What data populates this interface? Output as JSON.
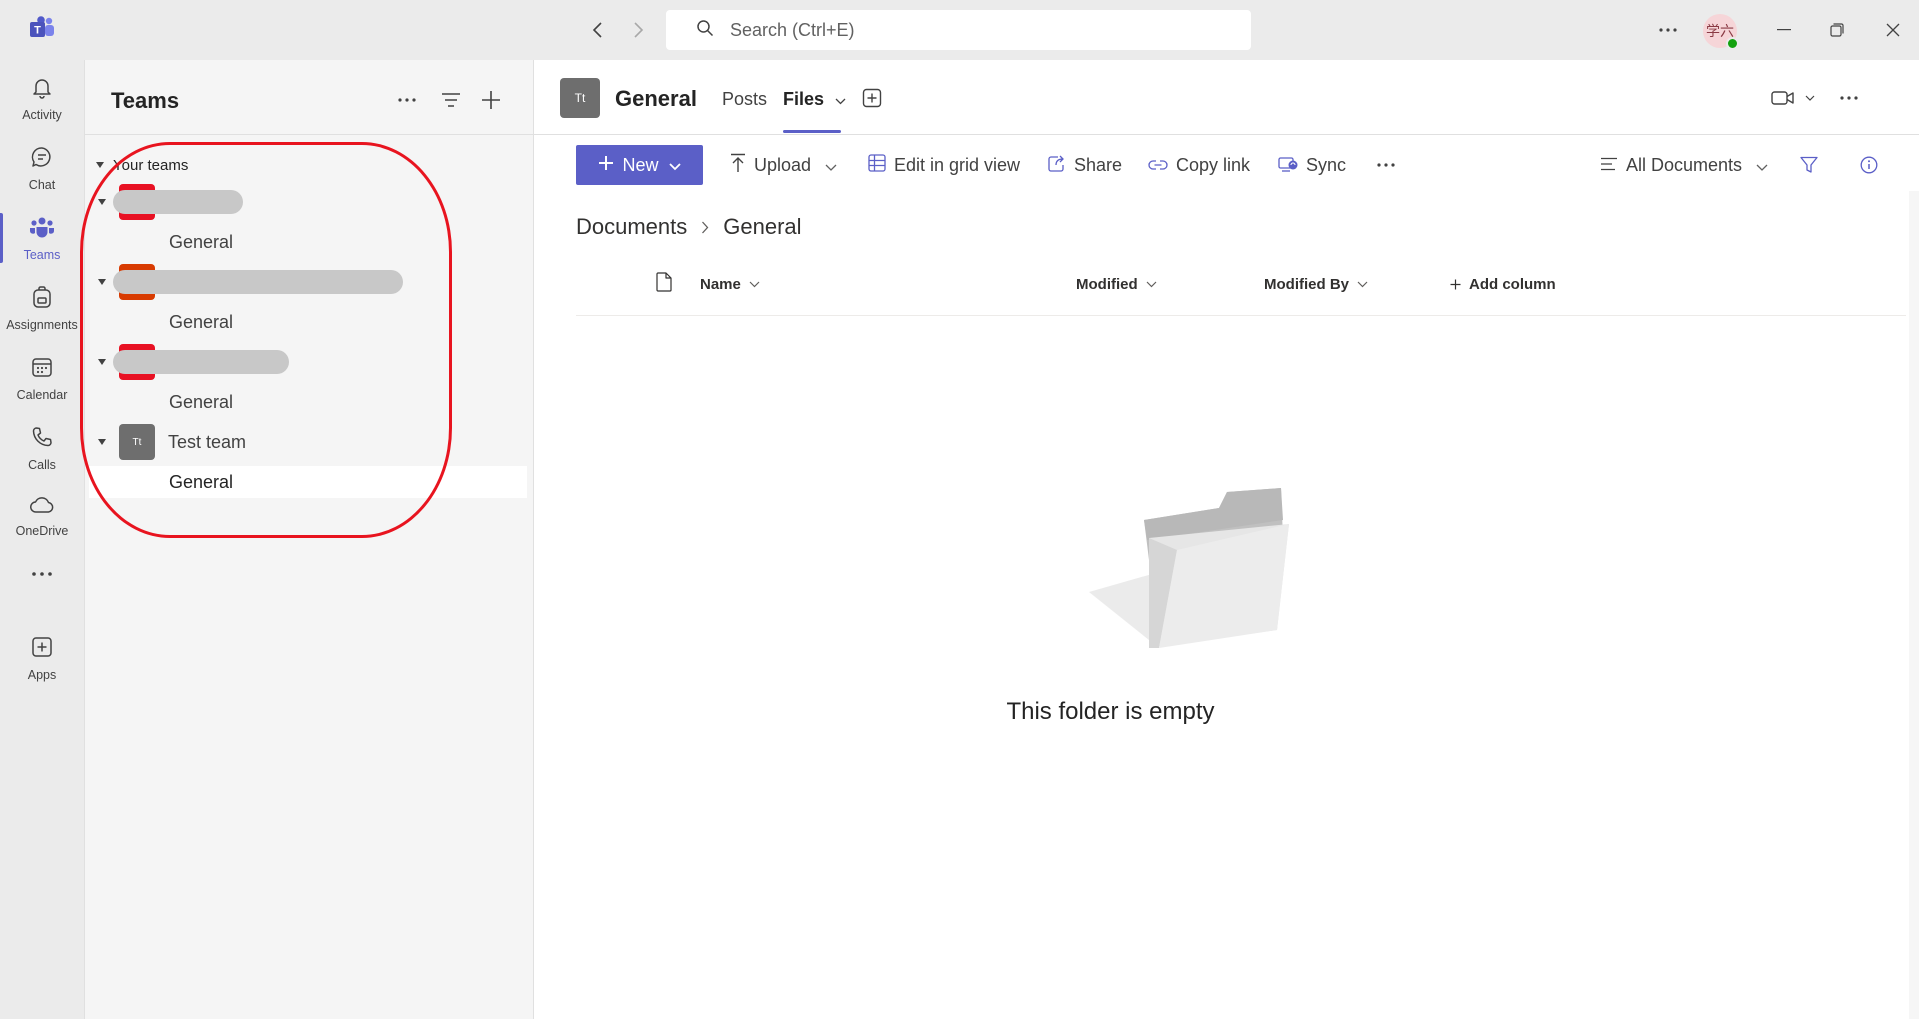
{
  "titlebar": {
    "search_placeholder": "Search (Ctrl+E)",
    "avatar_initials": "学六"
  },
  "appbar": {
    "items": [
      {
        "label": "Activity",
        "icon": "bell-icon"
      },
      {
        "label": "Chat",
        "icon": "chat-icon"
      },
      {
        "label": "Teams",
        "icon": "teams-icon",
        "active": true
      },
      {
        "label": "Assignments",
        "icon": "backpack-icon"
      },
      {
        "label": "Calendar",
        "icon": "calendar-icon"
      },
      {
        "label": "Calls",
        "icon": "phone-icon"
      },
      {
        "label": "OneDrive",
        "icon": "cloud-icon"
      },
      {
        "label": "Apps",
        "icon": "add-app-icon"
      }
    ]
  },
  "teams_panel": {
    "title": "Teams",
    "section_label": "Your teams",
    "teams": [
      {
        "name": "",
        "redacted": true,
        "tile_color": "#e81123",
        "channel": "General"
      },
      {
        "name": "",
        "redacted": true,
        "tile_color": "#d83b01",
        "channel": "General"
      },
      {
        "name": "",
        "redacted": true,
        "tile_color": "#e81123",
        "channel": "General"
      },
      {
        "name": "Test team",
        "redacted": false,
        "tile_initials": "Tt",
        "channel": "General",
        "selected": true
      }
    ]
  },
  "channel_header": {
    "tile_initials": "Tt",
    "title": "General",
    "tabs": [
      {
        "label": "Posts"
      },
      {
        "label": "Files",
        "active": true
      }
    ]
  },
  "toolbar": {
    "new_label": "New",
    "upload_label": "Upload",
    "edit_grid_label": "Edit in grid view",
    "share_label": "Share",
    "copy_link_label": "Copy link",
    "sync_label": "Sync",
    "view_label": "All Documents"
  },
  "breadcrumb": {
    "root": "Documents",
    "current": "General"
  },
  "columns": {
    "name": "Name",
    "modified": "Modified",
    "modified_by": "Modified By",
    "add_column": "Add column"
  },
  "empty_state": {
    "message": "This folder is empty"
  },
  "colors": {
    "accent": "#5b5fc7",
    "highlight_ring": "#e8141f"
  }
}
